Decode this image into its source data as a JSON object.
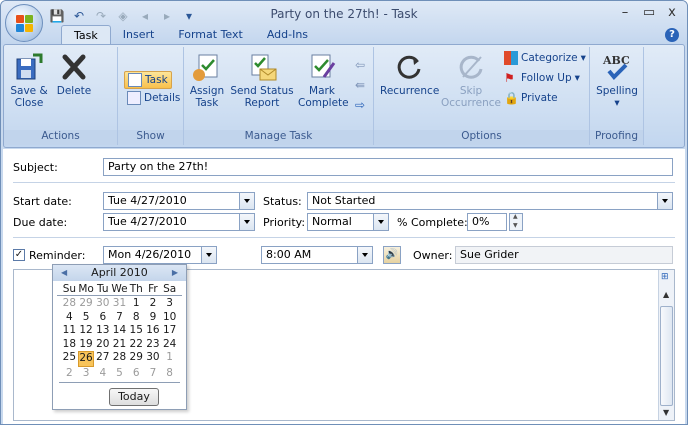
{
  "window": {
    "title": "Party on the 27th! - Task",
    "controls": [
      "–",
      "▭",
      "x"
    ]
  },
  "tabs": [
    "Task",
    "Insert",
    "Format Text",
    "Add-Ins"
  ],
  "ribbon": {
    "actions": {
      "save_close": "Save &\nClose",
      "save_line1": "Save &",
      "save_line2": "Close",
      "delete": "Delete",
      "label": "Actions"
    },
    "show": {
      "task": "Task",
      "details": "Details",
      "label": "Show"
    },
    "manage": {
      "assign_1": "Assign",
      "assign_2": "Task",
      "send_1": "Send Status",
      "send_2": "Report",
      "mark_1": "Mark",
      "mark_2": "Complete",
      "label": "Manage Task"
    },
    "options": {
      "recurrence": "Recurrence",
      "skip_1": "Skip",
      "skip_2": "Occurrence",
      "categorize": "Categorize",
      "followup": "Follow Up",
      "private": "Private",
      "label": "Options"
    },
    "proofing": {
      "spelling": "Spelling",
      "abc": "ABC",
      "label": "Proofing"
    }
  },
  "form": {
    "subject_label": "Subject:",
    "subject_value": "Party on the 27th!",
    "start_label": "Start date:",
    "start_value": "Tue 4/27/2010",
    "due_label": "Due date:",
    "due_value": "Tue 4/27/2010",
    "status_label": "Status:",
    "status_value": "Not Started",
    "priority_label": "Priority:",
    "priority_value": "Normal",
    "complete_label": "% Complete:",
    "complete_value": "0%",
    "reminder_label": "Reminder:",
    "reminder_date": "Mon 4/26/2010",
    "reminder_time": "8:00 AM",
    "owner_label": "Owner:",
    "owner_value": "Sue Grider"
  },
  "calendar": {
    "month": "April 2010",
    "days_of_week": [
      "Su",
      "Mo",
      "Tu",
      "We",
      "Th",
      "Fr",
      "Sa"
    ],
    "weeks": [
      [
        "28",
        "29",
        "30",
        "31",
        "1",
        "2",
        "3"
      ],
      [
        "4",
        "5",
        "6",
        "7",
        "8",
        "9",
        "10"
      ],
      [
        "11",
        "12",
        "13",
        "14",
        "15",
        "16",
        "17"
      ],
      [
        "18",
        "19",
        "20",
        "21",
        "22",
        "23",
        "24"
      ],
      [
        "25",
        "26",
        "27",
        "28",
        "29",
        "30",
        "1"
      ],
      [
        "2",
        "3",
        "4",
        "5",
        "6",
        "7",
        "8"
      ]
    ],
    "selected": "26",
    "today_label": "Today"
  },
  "colors": {
    "accent": "#15428b",
    "ribbon_bg": "#cfdff2",
    "selected_day": "#f8c45a"
  }
}
